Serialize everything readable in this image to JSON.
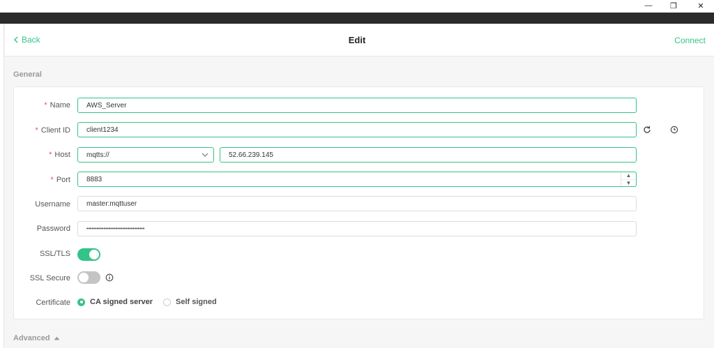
{
  "window": {
    "minimize_glyph": "—",
    "restore_glyph": "❐",
    "close_glyph": "✕"
  },
  "header": {
    "back_label": "Back",
    "title": "Edit",
    "connect_label": "Connect"
  },
  "sections": {
    "general": "General",
    "advanced": "Advanced"
  },
  "form": {
    "name": {
      "label": "Name",
      "value": "AWS_Server",
      "required": true
    },
    "client_id": {
      "label": "Client ID",
      "value": "client1234",
      "required": true
    },
    "host": {
      "label": "Host",
      "protocol": "mqtts://",
      "value": "52.66.239.145",
      "required": true
    },
    "port": {
      "label": "Port",
      "value": "8883",
      "required": true
    },
    "username": {
      "label": "Username",
      "value": "master:mqttuser"
    },
    "password": {
      "label": "Password",
      "value": "••••••••••••••••••••••••••••••••••"
    },
    "ssl_tls": {
      "label": "SSL/TLS",
      "enabled": true
    },
    "ssl_secure": {
      "label": "SSL Secure",
      "enabled": false
    },
    "certificate": {
      "label": "Certificate",
      "options": [
        "CA signed server",
        "Self signed"
      ],
      "selected": "CA signed server"
    },
    "required_mark": "*"
  },
  "colors": {
    "accent": "#34c388",
    "required": "#e5534b",
    "section_label": "#9a9a9a"
  },
  "icons": {
    "back": "chevron-left-icon",
    "refresh": "refresh-icon",
    "history": "clock-icon",
    "select": "chevron-down-icon",
    "info": "info-icon",
    "advanced": "caret-up-icon"
  }
}
